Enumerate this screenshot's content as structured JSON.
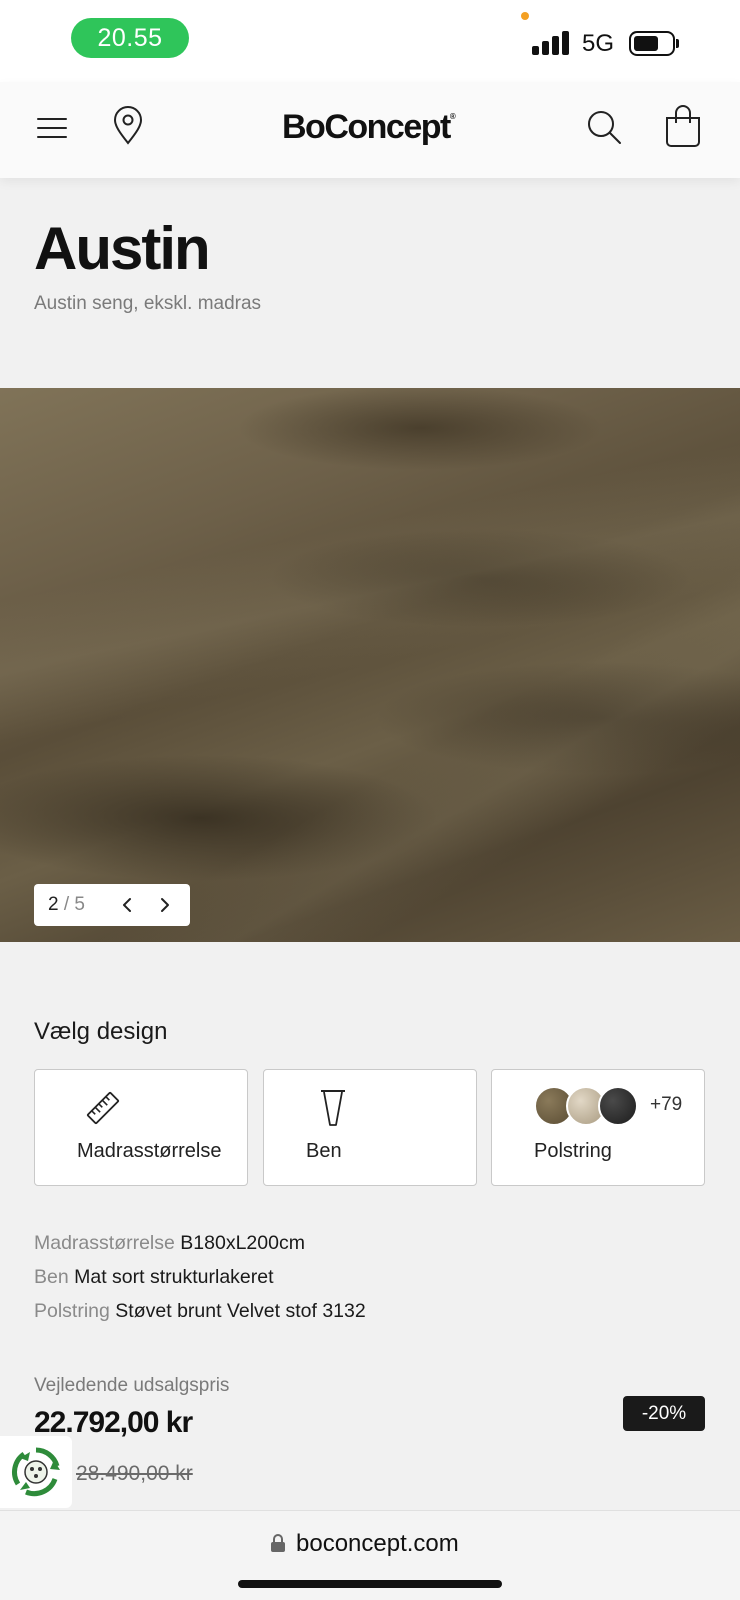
{
  "status_bar": {
    "time": "20.55",
    "network": "5G",
    "icons": [
      "signal-icon",
      "battery-icon"
    ]
  },
  "header": {
    "logo": "BoConcept",
    "logo_mark": "®",
    "icons": [
      "menu-icon",
      "location-pin-icon",
      "search-icon",
      "shopping-bag-icon"
    ]
  },
  "product": {
    "title": "Austin",
    "subtitle": "Austin seng, ekskl. madras"
  },
  "gallery": {
    "current": "2",
    "separator": "/",
    "total": "5",
    "prev_icon": "chevron-left-icon",
    "next_icon": "chevron-right-icon"
  },
  "design": {
    "heading": "Vælg design",
    "options": [
      {
        "label": "Madrasstørrelse",
        "icon": "ruler-icon"
      },
      {
        "label": "Ben",
        "icon": "table-leg-icon"
      },
      {
        "label": "Polstring",
        "icon": "fabric-swatches-icon",
        "more_count": "+79"
      }
    ]
  },
  "specs": [
    {
      "key": "Madrasstørrelse",
      "value": "B180xL200cm"
    },
    {
      "key": "Ben",
      "value": "Mat sort strukturlakeret"
    },
    {
      "key": "Polstring",
      "value": "Støvet brunt Velvet stof 3132"
    }
  ],
  "price": {
    "caption": "Vejledende udsalgspris",
    "current": "22.792,00 kr",
    "original": "28.490,00 kr",
    "discount": "-20%"
  },
  "browser": {
    "url": "boconcept.com",
    "lock_icon": "lock-icon"
  },
  "colors": {
    "time_pill": "#2fc55a",
    "badge": "#1a1a1a",
    "eco_green": "#2e8b3a"
  }
}
